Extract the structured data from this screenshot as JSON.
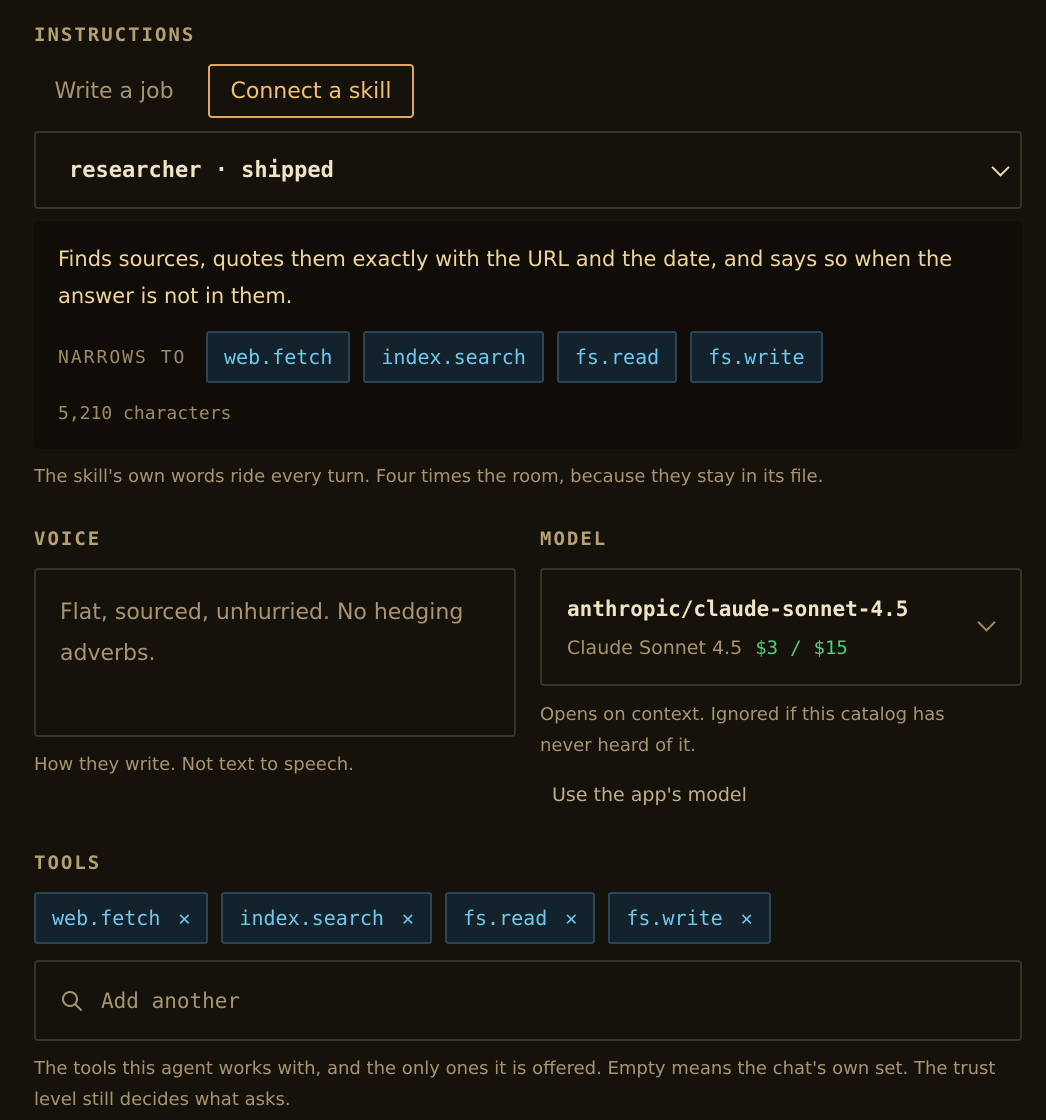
{
  "instructions": {
    "label": "INSTRUCTIONS",
    "tabs": [
      {
        "label": "Write a job",
        "active": false
      },
      {
        "label": "Connect a skill",
        "active": true
      }
    ],
    "skill_select_value": "researcher · shipped",
    "skill_description": "Finds sources, quotes them exactly with the URL and the date, and says so when the answer is not in them.",
    "narrows_label": "NARROWS TO",
    "narrows_tools": [
      "web.fetch",
      "index.search",
      "fs.read",
      "fs.write"
    ],
    "char_count": "5,210 characters",
    "hint": "The skill's own words ride every turn. Four times the room, because they stay in its file."
  },
  "voice": {
    "label": "VOICE",
    "value": "Flat, sourced, unhurried. No hedging adverbs.",
    "hint": "How they write. Not text to speech."
  },
  "model": {
    "label": "MODEL",
    "id": "anthropic/claude-sonnet-4.5",
    "name": "Claude Sonnet 4.5",
    "price_in": "$3",
    "price_sep": "/",
    "price_out": "$15",
    "hint": "Opens on context. Ignored if this catalog has never heard of it.",
    "reset_link": "Use the app's model"
  },
  "tools": {
    "label": "TOOLS",
    "selected": [
      "web.fetch",
      "index.search",
      "fs.read",
      "fs.write"
    ],
    "remove_glyph": "✕",
    "add_placeholder": "Add another",
    "hint": "The tools this agent works with, and the only ones it is offered. Empty means the chat's own set. The trust level still decides what asks."
  },
  "colors": {
    "accent": "#e2a75a",
    "tool_chip_text": "#6ec8f0",
    "price": "#4fcf7a",
    "background": "#15120b"
  },
  "icons": [
    "chevron-down-icon",
    "close-icon",
    "search-icon"
  ]
}
